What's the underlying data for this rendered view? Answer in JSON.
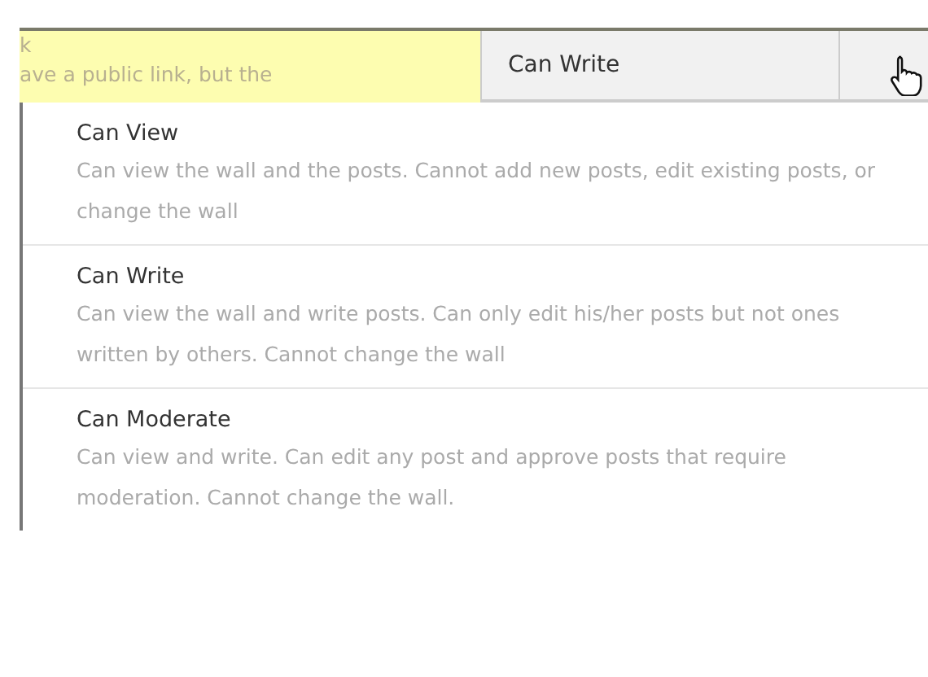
{
  "row": {
    "note_lines": [
      "k",
      "ave a public link, but the"
    ],
    "permission": "Can Write"
  },
  "menu": {
    "options": [
      {
        "title": "Can View",
        "description": "Can view the wall and the posts. Cannot add new posts, edit existing posts, or change the wall"
      },
      {
        "title": "Can Write",
        "description": "Can view the wall and write posts. Can only edit his/her posts but not ones written by others. Cannot change the wall"
      },
      {
        "title": "Can Moderate",
        "description": "Can view and write. Can edit any post and approve posts that require moderation. Cannot change the wall."
      }
    ]
  }
}
